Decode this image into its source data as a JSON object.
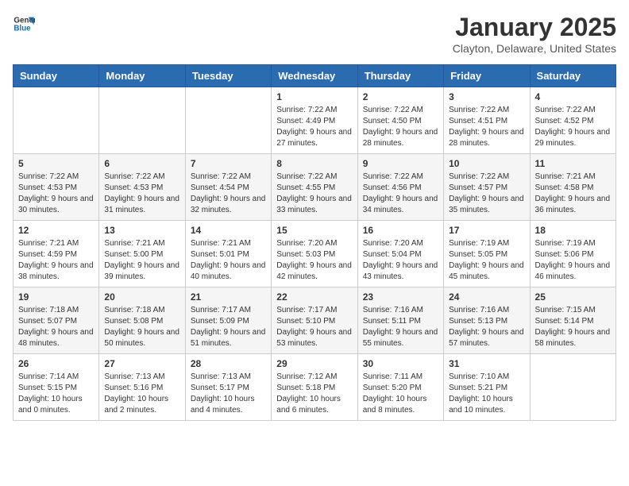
{
  "logo": {
    "general": "General",
    "blue": "Blue"
  },
  "header": {
    "month": "January 2025",
    "location": "Clayton, Delaware, United States"
  },
  "weekdays": [
    "Sunday",
    "Monday",
    "Tuesday",
    "Wednesday",
    "Thursday",
    "Friday",
    "Saturday"
  ],
  "weeks": [
    [
      {
        "day": "",
        "info": ""
      },
      {
        "day": "",
        "info": ""
      },
      {
        "day": "",
        "info": ""
      },
      {
        "day": "1",
        "info": "Sunrise: 7:22 AM\nSunset: 4:49 PM\nDaylight: 9 hours and 27 minutes."
      },
      {
        "day": "2",
        "info": "Sunrise: 7:22 AM\nSunset: 4:50 PM\nDaylight: 9 hours and 28 minutes."
      },
      {
        "day": "3",
        "info": "Sunrise: 7:22 AM\nSunset: 4:51 PM\nDaylight: 9 hours and 28 minutes."
      },
      {
        "day": "4",
        "info": "Sunrise: 7:22 AM\nSunset: 4:52 PM\nDaylight: 9 hours and 29 minutes."
      }
    ],
    [
      {
        "day": "5",
        "info": "Sunrise: 7:22 AM\nSunset: 4:53 PM\nDaylight: 9 hours and 30 minutes."
      },
      {
        "day": "6",
        "info": "Sunrise: 7:22 AM\nSunset: 4:53 PM\nDaylight: 9 hours and 31 minutes."
      },
      {
        "day": "7",
        "info": "Sunrise: 7:22 AM\nSunset: 4:54 PM\nDaylight: 9 hours and 32 minutes."
      },
      {
        "day": "8",
        "info": "Sunrise: 7:22 AM\nSunset: 4:55 PM\nDaylight: 9 hours and 33 minutes."
      },
      {
        "day": "9",
        "info": "Sunrise: 7:22 AM\nSunset: 4:56 PM\nDaylight: 9 hours and 34 minutes."
      },
      {
        "day": "10",
        "info": "Sunrise: 7:22 AM\nSunset: 4:57 PM\nDaylight: 9 hours and 35 minutes."
      },
      {
        "day": "11",
        "info": "Sunrise: 7:21 AM\nSunset: 4:58 PM\nDaylight: 9 hours and 36 minutes."
      }
    ],
    [
      {
        "day": "12",
        "info": "Sunrise: 7:21 AM\nSunset: 4:59 PM\nDaylight: 9 hours and 38 minutes."
      },
      {
        "day": "13",
        "info": "Sunrise: 7:21 AM\nSunset: 5:00 PM\nDaylight: 9 hours and 39 minutes."
      },
      {
        "day": "14",
        "info": "Sunrise: 7:21 AM\nSunset: 5:01 PM\nDaylight: 9 hours and 40 minutes."
      },
      {
        "day": "15",
        "info": "Sunrise: 7:20 AM\nSunset: 5:03 PM\nDaylight: 9 hours and 42 minutes."
      },
      {
        "day": "16",
        "info": "Sunrise: 7:20 AM\nSunset: 5:04 PM\nDaylight: 9 hours and 43 minutes."
      },
      {
        "day": "17",
        "info": "Sunrise: 7:19 AM\nSunset: 5:05 PM\nDaylight: 9 hours and 45 minutes."
      },
      {
        "day": "18",
        "info": "Sunrise: 7:19 AM\nSunset: 5:06 PM\nDaylight: 9 hours and 46 minutes."
      }
    ],
    [
      {
        "day": "19",
        "info": "Sunrise: 7:18 AM\nSunset: 5:07 PM\nDaylight: 9 hours and 48 minutes."
      },
      {
        "day": "20",
        "info": "Sunrise: 7:18 AM\nSunset: 5:08 PM\nDaylight: 9 hours and 50 minutes."
      },
      {
        "day": "21",
        "info": "Sunrise: 7:17 AM\nSunset: 5:09 PM\nDaylight: 9 hours and 51 minutes."
      },
      {
        "day": "22",
        "info": "Sunrise: 7:17 AM\nSunset: 5:10 PM\nDaylight: 9 hours and 53 minutes."
      },
      {
        "day": "23",
        "info": "Sunrise: 7:16 AM\nSunset: 5:11 PM\nDaylight: 9 hours and 55 minutes."
      },
      {
        "day": "24",
        "info": "Sunrise: 7:16 AM\nSunset: 5:13 PM\nDaylight: 9 hours and 57 minutes."
      },
      {
        "day": "25",
        "info": "Sunrise: 7:15 AM\nSunset: 5:14 PM\nDaylight: 9 hours and 58 minutes."
      }
    ],
    [
      {
        "day": "26",
        "info": "Sunrise: 7:14 AM\nSunset: 5:15 PM\nDaylight: 10 hours and 0 minutes."
      },
      {
        "day": "27",
        "info": "Sunrise: 7:13 AM\nSunset: 5:16 PM\nDaylight: 10 hours and 2 minutes."
      },
      {
        "day": "28",
        "info": "Sunrise: 7:13 AM\nSunset: 5:17 PM\nDaylight: 10 hours and 4 minutes."
      },
      {
        "day": "29",
        "info": "Sunrise: 7:12 AM\nSunset: 5:18 PM\nDaylight: 10 hours and 6 minutes."
      },
      {
        "day": "30",
        "info": "Sunrise: 7:11 AM\nSunset: 5:20 PM\nDaylight: 10 hours and 8 minutes."
      },
      {
        "day": "31",
        "info": "Sunrise: 7:10 AM\nSunset: 5:21 PM\nDaylight: 10 hours and 10 minutes."
      },
      {
        "day": "",
        "info": ""
      }
    ]
  ]
}
